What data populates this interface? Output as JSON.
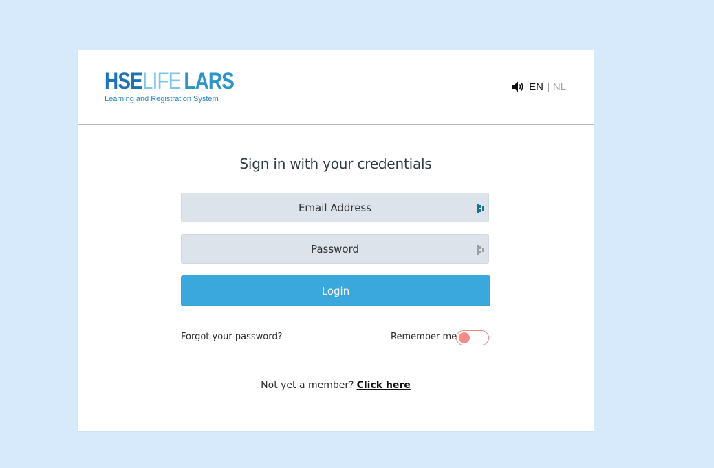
{
  "logo": {
    "part_hse": "HSE",
    "part_life": "LIFE",
    "part_lars": "LARS",
    "tagline": "Learning and Registration System"
  },
  "language": {
    "icon": "speaker-icon",
    "current": "EN",
    "separator": "|",
    "other": "NL"
  },
  "form": {
    "title": "Sign in with your credentials",
    "email_placeholder": "Email Address",
    "password_placeholder": "Password",
    "login_label": "Login",
    "forgot_label": "Forgot your password?",
    "remember_label": "Remember me",
    "remember_on": false,
    "signup_prompt": "Not yet a member?",
    "signup_link": "Click here"
  },
  "colors": {
    "background": "#d6eafb",
    "card": "#ffffff",
    "input_bg": "#dde3eb",
    "button": "#3ba8dd",
    "toggle_off": "#f78a8a",
    "logo_dark": "#1e73b4",
    "logo_light": "#7fc5e8"
  }
}
